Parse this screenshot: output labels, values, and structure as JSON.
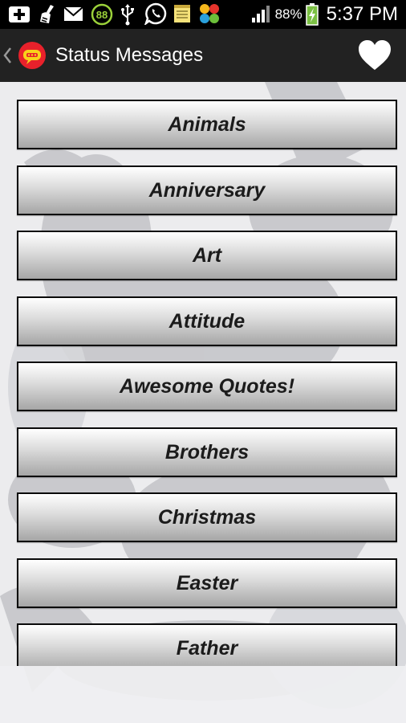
{
  "status_bar": {
    "battery_percent": "88%",
    "time": "5:37 PM",
    "notification_badge": "88",
    "icons": [
      "add-notification-icon",
      "cleaner-icon",
      "mail-icon",
      "badge-88-icon",
      "usb-icon",
      "whatsapp-icon",
      "notes-icon",
      "pinwheel-app-icon",
      "signal-icon",
      "battery-charging-icon"
    ]
  },
  "action_bar": {
    "title": "Status Messages",
    "logo_icon": "chat-bubble-logo-icon",
    "back_icon": "chevron-left-icon",
    "favorite_icon": "heart-icon"
  },
  "categories": [
    {
      "label": "Animals"
    },
    {
      "label": "Anniversary"
    },
    {
      "label": "Art"
    },
    {
      "label": "Attitude"
    },
    {
      "label": "Awesome Quotes!"
    },
    {
      "label": "Brothers"
    },
    {
      "label": "Christmas"
    },
    {
      "label": "Easter"
    },
    {
      "label": "Father"
    }
  ],
  "colors": {
    "status_bar_bg": "#000000",
    "action_bar_bg": "#222222",
    "logo_red": "#e8212b",
    "logo_yellow": "#f8d21a",
    "button_border": "#0a0a0a",
    "battery_green": "#7bc043"
  }
}
